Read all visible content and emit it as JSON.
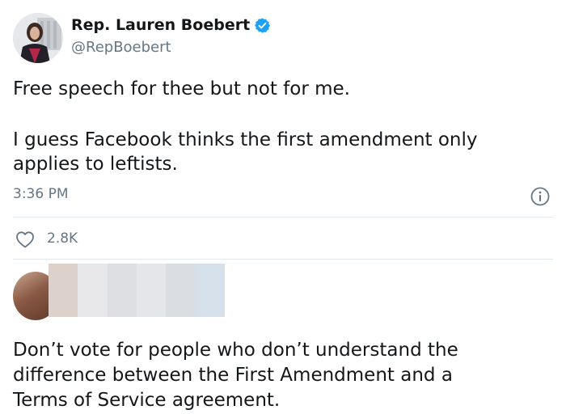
{
  "tweet": {
    "author": {
      "display_name": "Rep. Lauren Boebert",
      "handle": "@RepBoebert",
      "verified": true
    },
    "text_lines": [
      "Free speech for thee but not for me.",
      "I guess Facebook thinks the first amendment only",
      "applies to leftists."
    ],
    "time": "3:36 PM",
    "likes": "2.8K"
  },
  "reply": {
    "author_redacted": true,
    "text_lines": [
      "Don’t vote for people who don’t understand the",
      "difference between the First Amendment and a",
      "Terms of Service agreement."
    ]
  },
  "colors": {
    "text_primary": "#14171a",
    "text_secondary": "#657786",
    "verified_blue": "#1da1f2",
    "divider": "#e1e8ed"
  },
  "icons": {
    "verified": "verified-badge-icon",
    "info": "info-icon",
    "like": "heart-icon"
  }
}
